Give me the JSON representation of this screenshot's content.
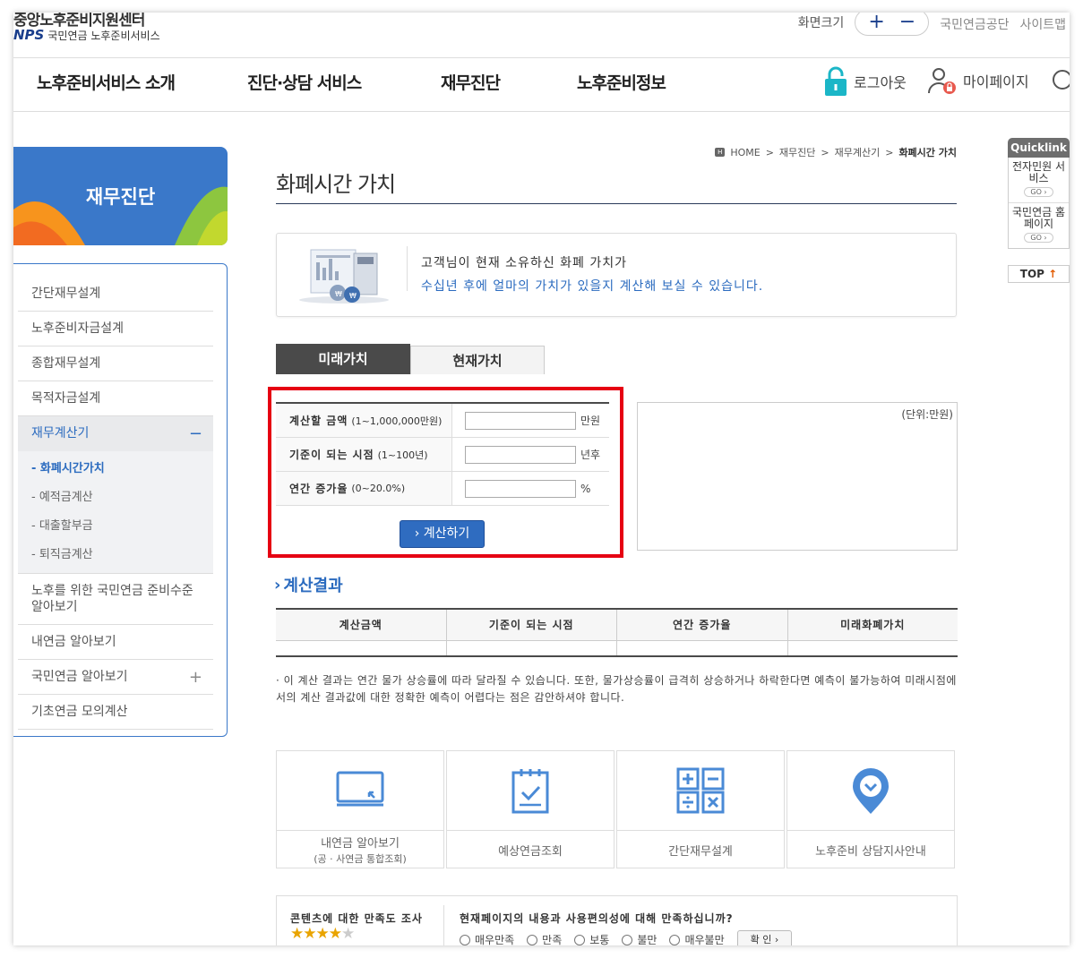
{
  "header": {
    "site_name": "중앙노후준비지원센터",
    "logo_nps": "NPS",
    "logo_sub": "국민연금 노후준비서비스",
    "fontsize_label": "화면크기",
    "fontsize_plus": "+",
    "fontsize_minus": "−",
    "links": [
      "국민연금공단",
      "사이트맵"
    ]
  },
  "gnb": {
    "items": [
      "노후준비서비스 소개",
      "진단·상담 서비스",
      "재무진단",
      "노후준비정보"
    ],
    "logout": "로그아웃",
    "mypage": "마이페이지"
  },
  "lnb": {
    "title": "재무진단",
    "items": [
      "간단재무설계",
      "노후준비자금설계",
      "종합재무설계",
      "목적자금설계",
      "재무계산기",
      "노후를 위한 국민연금 준비수준 알아보기",
      "내연금 알아보기",
      "국민연금 알아보기",
      "기초연금 모의계산"
    ],
    "active_sign": "−",
    "plus_sign": "+",
    "sub_items": [
      "- 화폐시간가치",
      "- 예적금계산",
      "- 대출할부금",
      "- 퇴직금계산"
    ]
  },
  "breadcrumb": {
    "home": "HOME",
    "items": [
      "재무진단",
      "재무계산기",
      "화폐시간 가치"
    ],
    "sep": ">"
  },
  "page": {
    "title": "화폐시간 가치",
    "intro_line1": "고객님이 현재 소유하신 화폐 가치가",
    "intro_line2": "수십년 후에 얼마의 가치가 있을지 계산해 보실 수 있습니다."
  },
  "tabs": [
    "미래가치",
    "현재가치"
  ],
  "form": {
    "rows": [
      {
        "label": "계산할 금액",
        "range": "(1~1,000,000만원)",
        "value": "",
        "unit": "만원"
      },
      {
        "label": "기준이 되는 시점",
        "range": "(1~100년)",
        "value": "",
        "unit": "년후"
      },
      {
        "label": "연간 증가율",
        "range": "(0~20.0%)",
        "value": "",
        "unit": "%"
      }
    ],
    "button": "› 계산하기"
  },
  "result_panel": {
    "unit": "(단위:만원)"
  },
  "results": {
    "title": "계산결과",
    "headers": [
      "계산금액",
      "기준이 되는 시점",
      "연간 증가율",
      "미래화폐가치"
    ],
    "notice": "· 이 계산 결과는 연간 물가 상승률에 따라 달라질 수 있습니다. 또한, 물가상승률이 급격히 상승하거나 하락한다면 예측이 불가능하여 미래시점에서의 계산 결과값에 대한 정확한 예측이 어렵다는 점은 감안하셔야 합니다."
  },
  "quick_cards": [
    {
      "label": "내연금 알아보기",
      "sub": "(공 · 사연금 통합조회)",
      "icon": "monitor-icon"
    },
    {
      "label": "예상연금조회",
      "sub": "",
      "icon": "checklist-icon"
    },
    {
      "label": "간단재무설계",
      "sub": "",
      "icon": "calculator-icon"
    },
    {
      "label": "노후준비 상담지사안내",
      "sub": "",
      "icon": "location-pin-icon"
    }
  ],
  "survey": {
    "title": "콘텐츠에 대한 만족도 조사",
    "rating": 4,
    "rating_max": 5,
    "question": "현재페이지의 내용과 사용편의성에 대해 만족하십니까?",
    "options": [
      "매우만족",
      "만족",
      "보통",
      "불만",
      "매우불만"
    ],
    "button": "확 인 ›"
  },
  "quicklink": {
    "title": "Quicklink",
    "items": [
      {
        "label": "전자민원 서비스",
        "go": "GO ›"
      },
      {
        "label": "국민연금 홈페이지",
        "go": "GO ›"
      }
    ],
    "top": "TOP",
    "top_arrow": "↑"
  },
  "colors": {
    "primary_blue": "#2b6bbf",
    "highlight_red": "#e60012",
    "lnb_banner": "#3a78c9"
  }
}
